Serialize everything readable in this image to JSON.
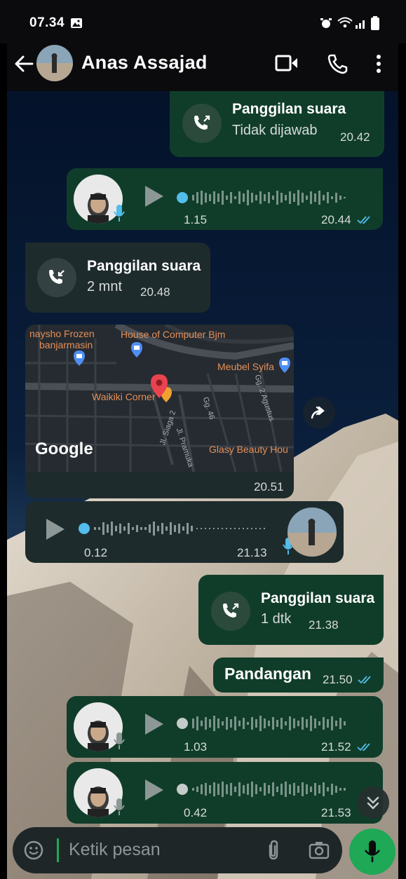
{
  "status_bar": {
    "time": "07.34"
  },
  "header": {
    "contact_name": "Anas Assajad"
  },
  "messages": {
    "call1": {
      "title": "Panggilan suara",
      "status": "Tidak dijawab",
      "time": "20.42"
    },
    "voice1": {
      "duration": "1.15",
      "time": "20.44"
    },
    "call2": {
      "title": "Panggilan suara",
      "duration": "2 mnt",
      "time": "20.48"
    },
    "location": {
      "time": "20.51",
      "labels": [
        "naysho Frozen",
        "banjarmasin",
        "House of Computer Bjm",
        "Meubel Syifa",
        "Waikiki Corner",
        "Jl. Siaga 2",
        "Jl. Pramuka",
        "Gg. 46",
        "Gg. 2 Agustus",
        "Glasy Beauty Hou"
      ],
      "provider": "Google"
    },
    "voice2": {
      "duration": "0.12",
      "time": "21.13"
    },
    "call3": {
      "title": "Panggilan suara",
      "duration": "1 dtk",
      "time": "21.38"
    },
    "text1": {
      "text": "Pandangan",
      "time": "21.50"
    },
    "voice3": {
      "duration": "1.03",
      "time": "21.52"
    },
    "voice4": {
      "duration": "0.42",
      "time": "21.53"
    }
  },
  "input": {
    "placeholder": "Ketik pesan"
  },
  "colors": {
    "outgoing_bubble": "#103d2a",
    "incoming_bubble": "#1e2b2d",
    "read_ticks": "#53bdeb",
    "accent_green": "#1fa855"
  }
}
